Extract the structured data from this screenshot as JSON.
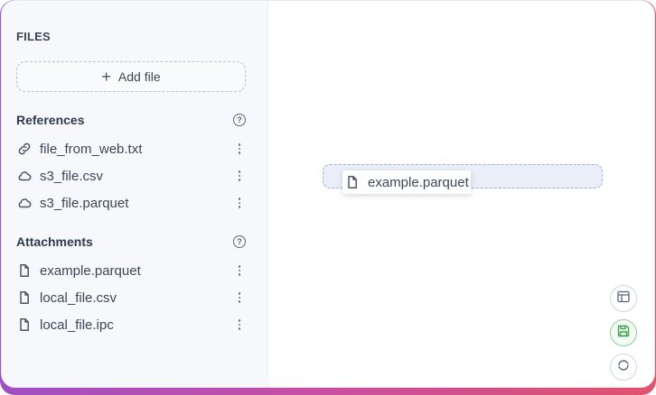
{
  "sidebar": {
    "title": "FILES",
    "add_file_label": "Add file",
    "references": {
      "label": "References",
      "items": [
        {
          "name": "file_from_web.txt",
          "icon": "link-icon"
        },
        {
          "name": "s3_file.csv",
          "icon": "cloud-icon"
        },
        {
          "name": "s3_file.parquet",
          "icon": "cloud-icon"
        }
      ]
    },
    "attachments": {
      "label": "Attachments",
      "items": [
        {
          "name": "example.parquet",
          "icon": "file-icon"
        },
        {
          "name": "local_file.csv",
          "icon": "file-icon"
        },
        {
          "name": "local_file.ipc",
          "icon": "file-icon"
        }
      ]
    }
  },
  "canvas": {
    "drag_item": {
      "name": "example.parquet",
      "icon": "file-icon"
    }
  },
  "actions": {
    "icons": [
      "layout-icon",
      "save-icon",
      "refresh-icon"
    ],
    "save_color": "#3fa34d"
  },
  "colors": {
    "accent_gradient": [
      "#9f4fc4",
      "#c94fa2",
      "#e0536b"
    ],
    "drop_zone_border": "#9eb0d6"
  }
}
